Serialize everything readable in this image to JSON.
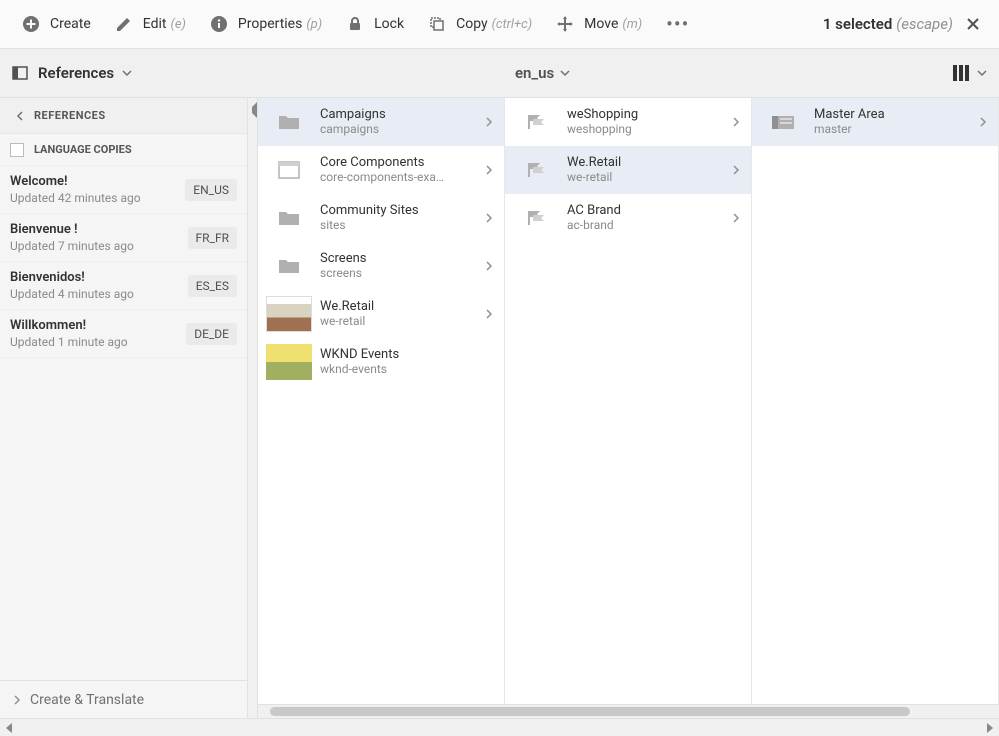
{
  "actions": {
    "create": "Create",
    "edit": "Edit",
    "edit_hint": "(e)",
    "properties": "Properties",
    "properties_hint": "(p)",
    "lock": "Lock",
    "copy": "Copy",
    "copy_hint": "(ctrl+c)",
    "move": "Move",
    "move_hint": "(m)",
    "selected_count": "1 selected",
    "escape_hint": "(escape)"
  },
  "rail": {
    "toggle_label": "References",
    "header": "REFERENCES",
    "sub_label": "LANGUAGE COPIES",
    "footer": "Create & Translate",
    "copies": [
      {
        "title": "Welcome!",
        "updated": "Updated 42 minutes ago",
        "locale": "EN_US"
      },
      {
        "title": "Bienvenue !",
        "updated": "Updated 7 minutes ago",
        "locale": "FR_FR"
      },
      {
        "title": "Bienvenidos!",
        "updated": "Updated 4 minutes ago",
        "locale": "ES_ES"
      },
      {
        "title": "Willkommen!",
        "updated": "Updated 1 minute ago",
        "locale": "DE_DE"
      }
    ]
  },
  "breadcrumb": {
    "label": "en_us"
  },
  "columns": [
    {
      "items": [
        {
          "title": "Campaigns",
          "sub": "campaigns",
          "icon": "folder",
          "selected": true,
          "chevron": true
        },
        {
          "title": "Core Components",
          "sub": "core-components-exa…",
          "icon": "template",
          "selected": false,
          "chevron": true
        },
        {
          "title": "Community Sites",
          "sub": "sites",
          "icon": "folder",
          "selected": false,
          "chevron": true
        },
        {
          "title": "Screens",
          "sub": "screens",
          "icon": "folder",
          "selected": false,
          "chevron": true
        },
        {
          "title": "We.Retail",
          "sub": "we-retail",
          "icon": "image1",
          "selected": false,
          "chevron": true
        },
        {
          "title": "WKND Events",
          "sub": "wknd-events",
          "icon": "image2",
          "selected": false,
          "chevron": false
        }
      ]
    },
    {
      "items": [
        {
          "title": "weShopping",
          "sub": "weshopping",
          "icon": "flag",
          "selected": false,
          "chevron": true
        },
        {
          "title": "We.Retail",
          "sub": "we-retail",
          "icon": "flag",
          "selected": true,
          "chevron": true
        },
        {
          "title": "AC Brand",
          "sub": "ac-brand",
          "icon": "flag",
          "selected": false,
          "chevron": true
        }
      ]
    },
    {
      "items": [
        {
          "title": "Master Area",
          "sub": "master",
          "icon": "master",
          "selected": true,
          "chevron": true
        }
      ]
    }
  ]
}
